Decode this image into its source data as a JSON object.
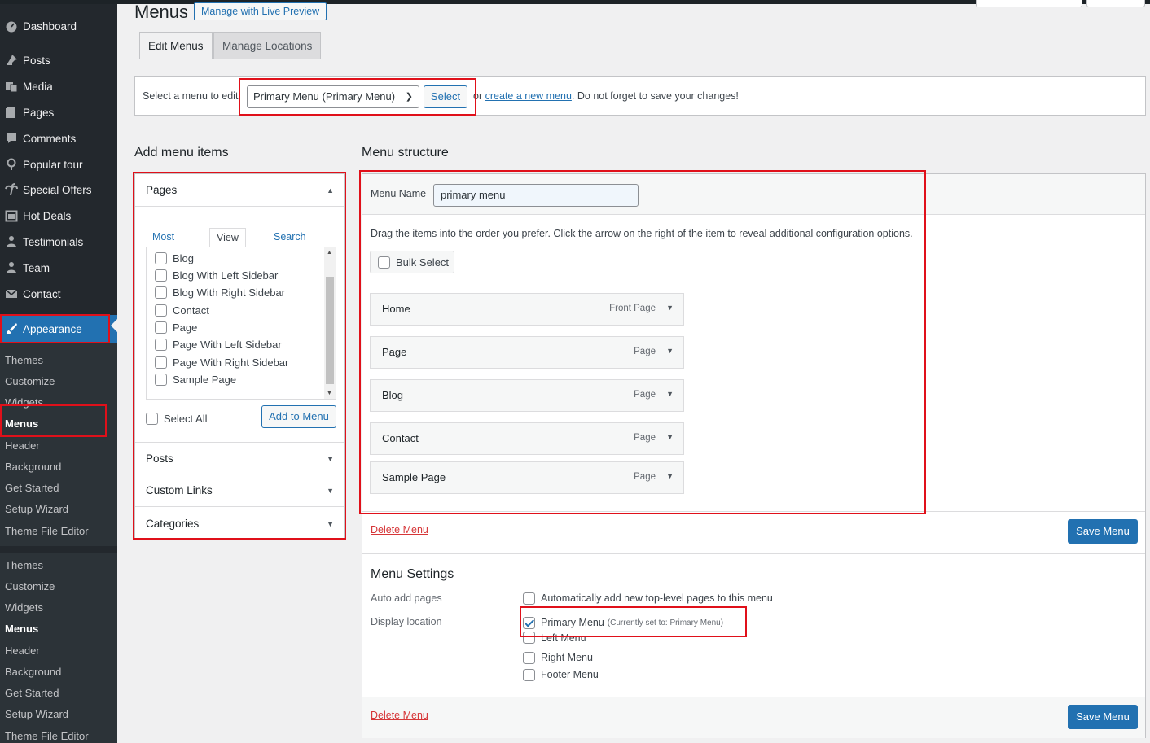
{
  "sidebar": {
    "items": [
      {
        "label": "Dashboard",
        "icon": "dashboard-icon"
      },
      {
        "label": "Posts",
        "icon": "pin-icon"
      },
      {
        "label": "Media",
        "icon": "media-icon"
      },
      {
        "label": "Pages",
        "icon": "pages-icon"
      },
      {
        "label": "Comments",
        "icon": "comment-icon"
      },
      {
        "label": "Popular tour",
        "icon": "location-icon"
      },
      {
        "label": "Special Offers",
        "icon": "palm-tree-icon"
      },
      {
        "label": "Hot Deals",
        "icon": "calendar-icon"
      },
      {
        "label": "Testimonials",
        "icon": "user-icon"
      },
      {
        "label": "Team",
        "icon": "user-icon"
      },
      {
        "label": "Contact",
        "icon": "mail-icon"
      },
      {
        "label": "Appearance",
        "icon": "paintbrush-icon"
      }
    ],
    "submenu_a": [
      "Themes",
      "Customize",
      "Widgets",
      "Menus",
      "Header",
      "Background",
      "Get Started",
      "Setup Wizard",
      "Theme File Editor"
    ],
    "submenu_b": [
      "Themes",
      "Customize",
      "Widgets",
      "Menus",
      "Header",
      "Background",
      "Get Started",
      "Setup Wizard",
      "Theme File Editor"
    ]
  },
  "header": {
    "title": "Menus",
    "live_preview": "Manage with Live Preview"
  },
  "tabs": [
    "Edit Menus",
    "Manage Locations"
  ],
  "select_bar": {
    "label": "Select a menu to edit:",
    "selected": "Primary Menu (Primary Menu)",
    "select_button": "Select",
    "or_text": "or",
    "create_link": "create a new menu",
    "reminder": ". Do not forget to save your changes!"
  },
  "add_items": {
    "title": "Add menu items",
    "pages_heading": "Pages",
    "mini_tabs": [
      "Most Recent",
      "View All",
      "Search"
    ],
    "pages": [
      "Blog",
      "Blog With Left Sidebar",
      "Blog With Right Sidebar",
      "Contact",
      "Page",
      "Page With Left Sidebar",
      "Page With Right Sidebar",
      "Sample Page"
    ],
    "select_all": "Select All",
    "add_button": "Add to Menu",
    "sections": [
      "Posts",
      "Custom Links",
      "Categories"
    ]
  },
  "structure": {
    "title": "Menu structure",
    "name_label": "Menu Name",
    "name_value": "primary menu",
    "instructions": "Drag the items into the order you prefer. Click the arrow on the right of the item to reveal additional configuration options.",
    "bulk_select": "Bulk Select",
    "items": [
      {
        "title": "Home",
        "type": "Front Page"
      },
      {
        "title": "Page",
        "type": "Page"
      },
      {
        "title": "Blog",
        "type": "Page"
      },
      {
        "title": "Contact",
        "type": "Page"
      },
      {
        "title": "Sample Page",
        "type": "Page"
      }
    ],
    "delete": "Delete Menu",
    "save": "Save Menu"
  },
  "settings": {
    "title": "Menu Settings",
    "auto_label": "Auto add pages",
    "auto_option": "Automatically add new top-level pages to this menu",
    "display_label": "Display location",
    "locations": [
      {
        "label": "Primary Menu",
        "note": "(Currently set to: Primary Menu)",
        "checked": true
      },
      {
        "label": "Left Menu",
        "note": "",
        "checked": false
      },
      {
        "label": "Right Menu",
        "note": "",
        "checked": false
      },
      {
        "label": "Footer Menu",
        "note": "",
        "checked": false
      }
    ],
    "delete": "Delete Menu",
    "save": "Save Menu"
  },
  "colors": {
    "accent": "#2271b1",
    "highlight_box": "#e0101a",
    "sidebar": "#23282d"
  }
}
